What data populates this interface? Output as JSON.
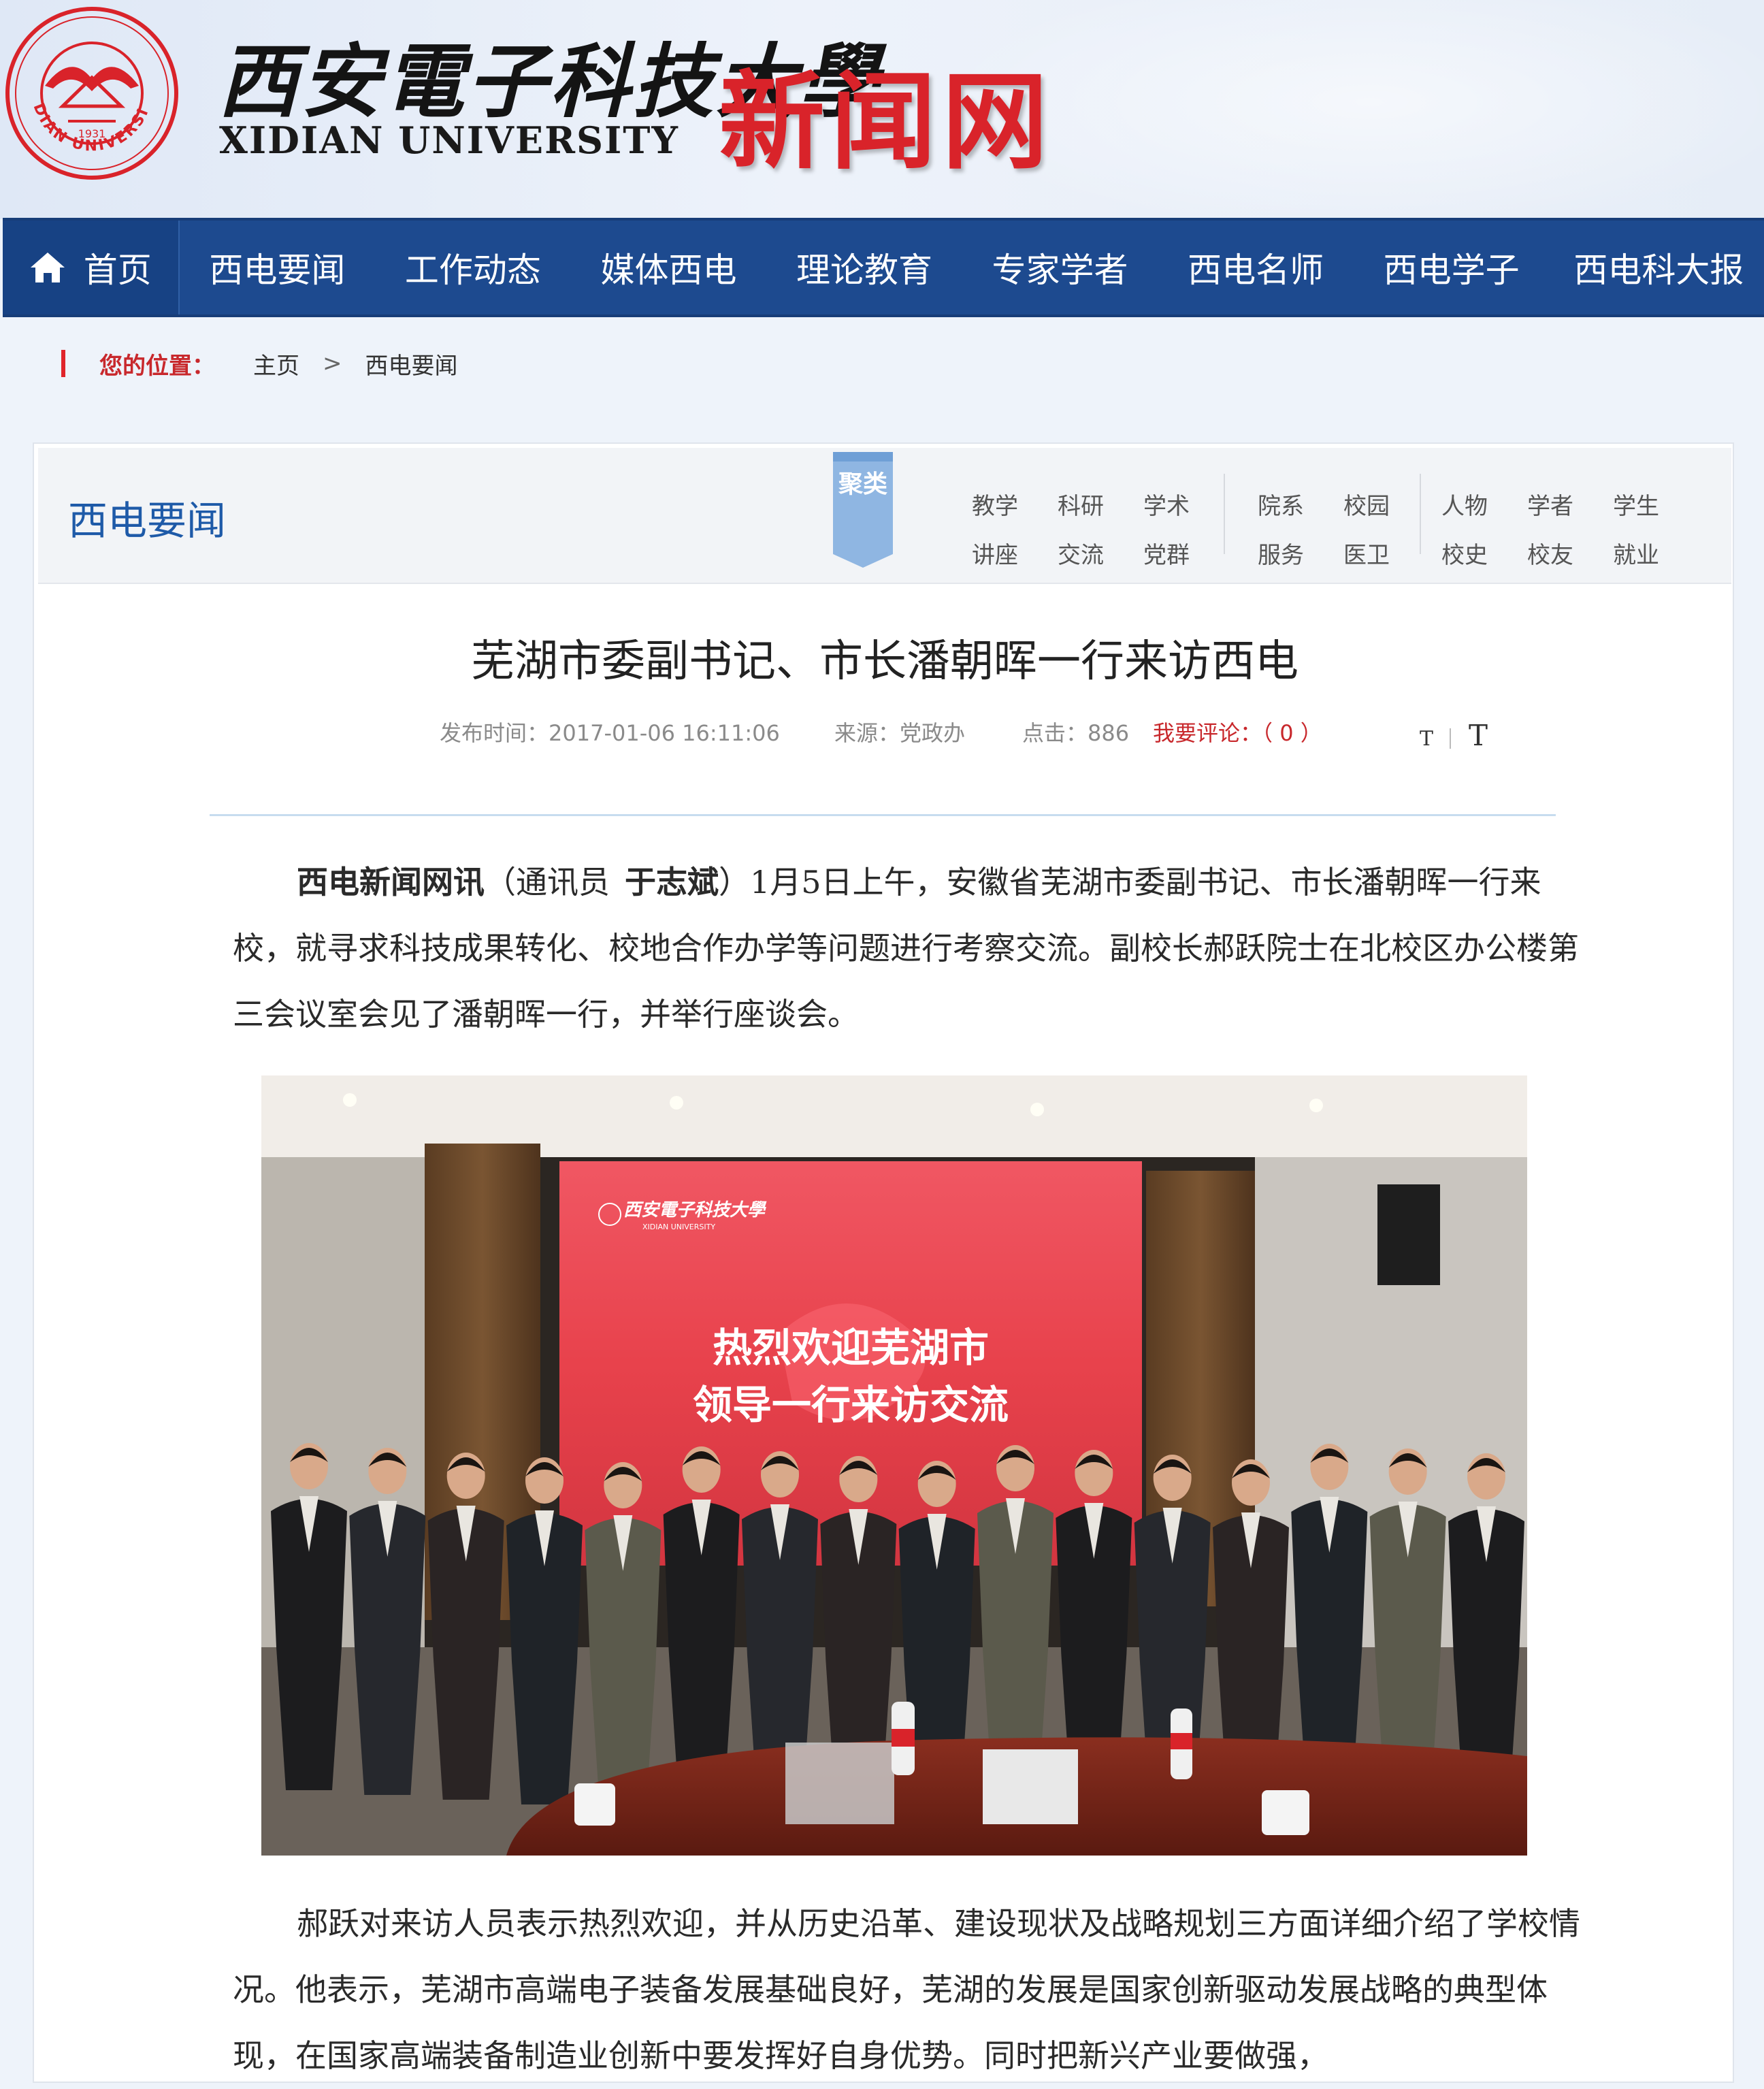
{
  "header": {
    "university_cn": "西安電子科技大學",
    "university_en": "XIDIAN UNIVERSITY",
    "site_name": "新闻网",
    "seal_text": "XIDIAN UNIVERSITY",
    "seal_year": "1931"
  },
  "nav": {
    "home": "首页",
    "items": [
      "西电要闻",
      "工作动态",
      "媒体西电",
      "理论教育",
      "专家学者",
      "西电名师",
      "西电学子",
      "西电科大报"
    ]
  },
  "breadcrumb": {
    "label": "您的位置：",
    "home": "主页",
    "separator": ">",
    "current": "西电要闻"
  },
  "section": {
    "title": "西电要闻",
    "cluster_label": "聚类",
    "categories": [
      [
        "教学",
        "讲座"
      ],
      [
        "科研",
        "交流"
      ],
      [
        "学术",
        "党群"
      ],
      [
        "院系",
        "服务"
      ],
      [
        "校园",
        "医卫"
      ],
      [
        "人物",
        "校史"
      ],
      [
        "学者",
        "校友"
      ],
      [
        "学生",
        "就业"
      ]
    ]
  },
  "article": {
    "title": "芜湖市委副书记、市长潘朝晖一行来访西电",
    "publish_label": "发布时间：",
    "publish_time": "2017-01-06 16:11:06",
    "source_label": "来源：",
    "source": "党政办",
    "clicks_label": "点击：",
    "clicks": "886",
    "comment_label": "我要评论：",
    "comment_count": "（ 0 ）",
    "font_small": "T",
    "font_large": "T",
    "lead_source": "西电新闻网讯",
    "lead_reporter_label": "（通讯员",
    "lead_reporter": "于志斌",
    "paragraph1_rest": "）1月5日上午，安徽省芜湖市委副书记、市长潘朝晖一行来校，就寻求科技成果转化、校地合作办学等问题进行考察交流。副校长郝跃院士在北校区办公楼第三会议室会见了潘朝晖一行，并举行座谈会。",
    "paragraph2": "郝跃对来访人员表示热烈欢迎，并从历史沿革、建设现状及战略规划三方面详细介绍了学校情况。他表示，芜湖市高端电子装备发展基础良好，芜湖的发展是国家创新驱动发展战略的典型体现，在国家高端装备制造业创新中要发挥好自身优势。同时把新兴产业要做强，"
  },
  "photo": {
    "screen_logo_cn": "西安電子科技大學",
    "screen_logo_en": "XIDIAN UNIVERSITY",
    "banner_line1": "热烈欢迎芜湖市",
    "banner_line2": "领导一行来访交流",
    "people_count": 16
  },
  "colors": {
    "nav_bg": "#1d4a8f",
    "brand_red": "#d9232a",
    "section_blue": "#1e5aa8",
    "screen_red": "#e8424c"
  }
}
